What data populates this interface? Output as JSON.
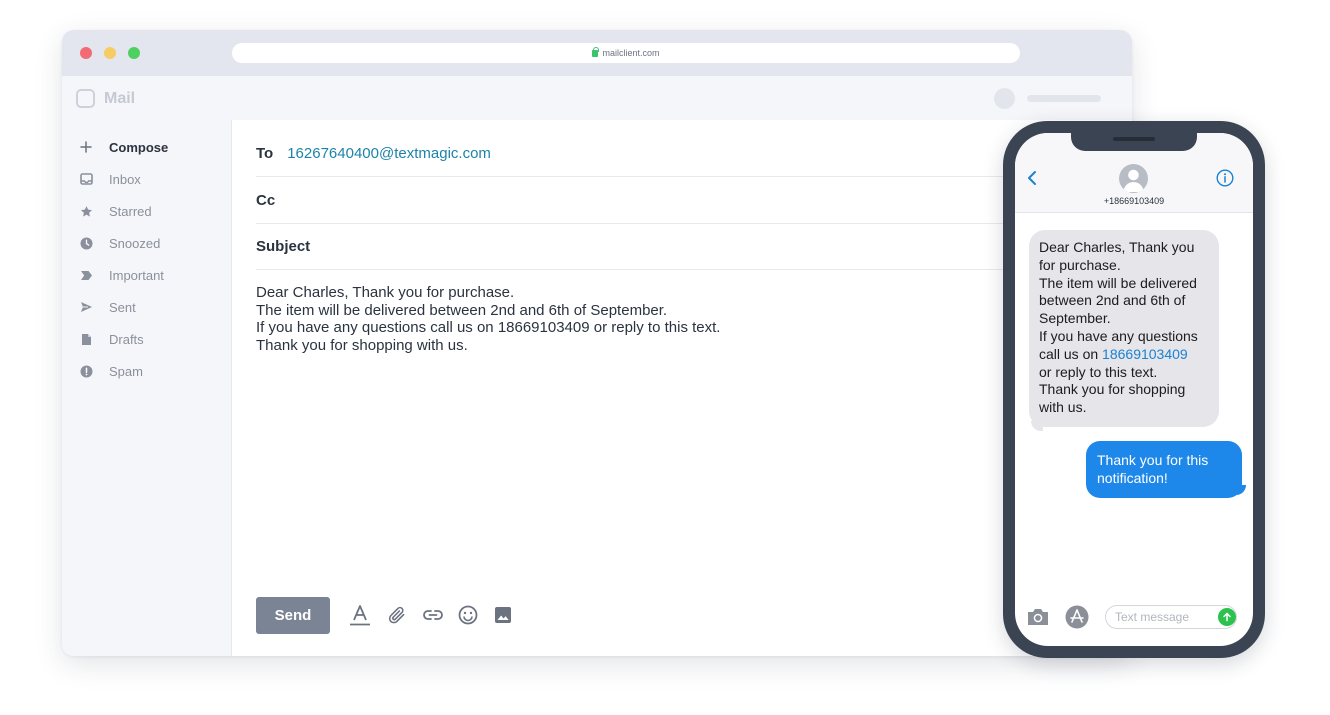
{
  "browser": {
    "url": "mailclient.com"
  },
  "app": {
    "name": "Mail"
  },
  "sidebar": {
    "items": [
      {
        "label": "Compose",
        "icon": "plus-icon"
      },
      {
        "label": "Inbox",
        "icon": "inbox-icon"
      },
      {
        "label": "Starred",
        "icon": "star-icon"
      },
      {
        "label": "Snoozed",
        "icon": "clock-icon"
      },
      {
        "label": "Important",
        "icon": "label-icon"
      },
      {
        "label": "Sent",
        "icon": "send-icon"
      },
      {
        "label": "Drafts",
        "icon": "file-icon"
      },
      {
        "label": "Spam",
        "icon": "alert-icon"
      }
    ]
  },
  "compose": {
    "to_label": "To",
    "to_value": "16267640400@textmagic.com",
    "cc_label": "Cc",
    "subject_label": "Subject",
    "body_lines": [
      "Dear Charles, Thank you for purchase.",
      "The item will be delivered between 2nd and 6th of September.",
      "If you have any questions call us on 18669103409 or reply to this text.",
      "Thank you for shopping with us."
    ],
    "send_label": "Send",
    "toolbar_icons": [
      "text-format-icon",
      "attachment-icon",
      "link-icon",
      "emoji-icon",
      "image-icon"
    ]
  },
  "phone": {
    "contact_number": "+18669103409",
    "incoming": {
      "lines": [
        "Dear Charles, Thank you",
        "for purchase.",
        "The item will be delivered",
        "between 2nd and 6th of",
        "September.",
        "If you have any questions"
      ],
      "call_prefix": "call us on ",
      "call_number": "18669103409",
      "tail_lines": [
        "or reply to this text.",
        "Thank you for shopping",
        "with us."
      ]
    },
    "outgoing": {
      "lines": [
        "Thank you for this",
        "notification!"
      ]
    },
    "input_placeholder": "Text message"
  },
  "colors": {
    "link": "#1c84a8",
    "send_button": "#7b8494",
    "sms_bubble_out": "#1e88ea",
    "sms_bubble_in": "#e5e5ea",
    "sms_send": "#2dc24f"
  }
}
